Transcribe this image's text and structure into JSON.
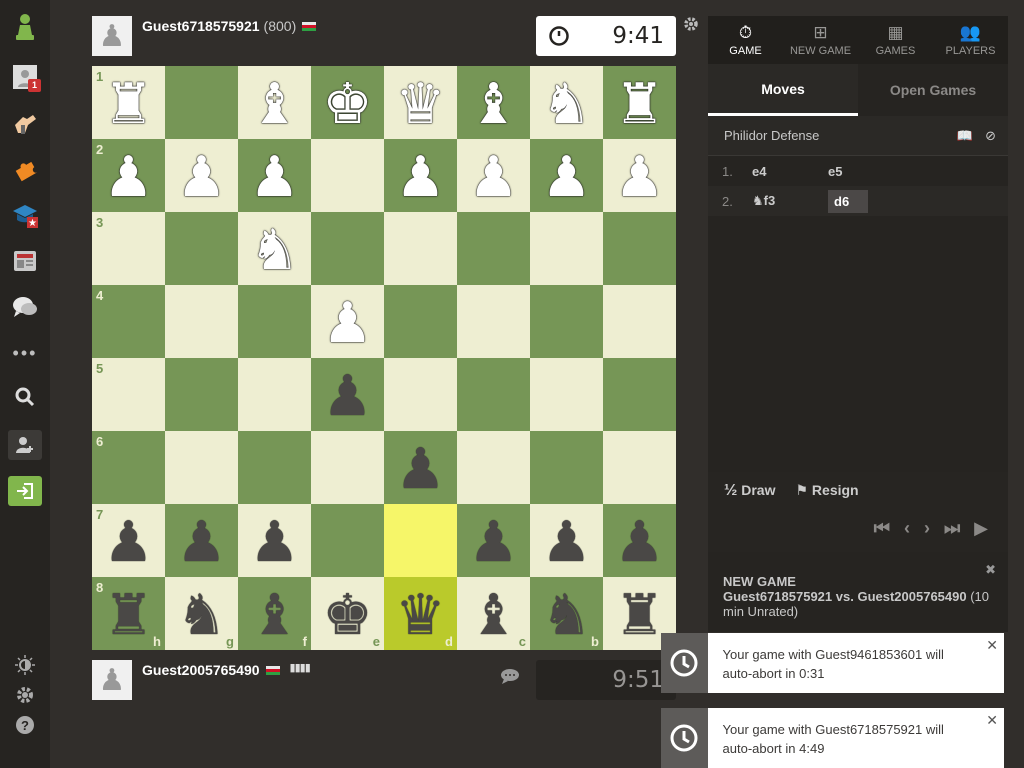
{
  "sidebar": {
    "items": [
      {
        "name": "chess-logo",
        "icon": "pawn-logo-icon"
      },
      {
        "name": "profile",
        "icon": "user-icon",
        "badge": "1"
      },
      {
        "name": "play",
        "icon": "hand-icon"
      },
      {
        "name": "puzzles",
        "icon": "puzzle-icon"
      },
      {
        "name": "learn",
        "icon": "graduation-icon"
      },
      {
        "name": "news",
        "icon": "news-icon"
      },
      {
        "name": "social",
        "icon": "chat-icon"
      },
      {
        "name": "more",
        "icon": "more-icon"
      },
      {
        "name": "search",
        "icon": "search-icon"
      },
      {
        "name": "add-friend",
        "icon": "user-add-icon"
      },
      {
        "name": "login",
        "icon": "login-icon"
      },
      {
        "name": "theme",
        "icon": "brightness-icon"
      },
      {
        "name": "settings",
        "icon": "gear-icon"
      },
      {
        "name": "help",
        "icon": "help-icon"
      }
    ]
  },
  "top_player": {
    "name": "Guest6718575921",
    "rating": "(800)",
    "clock": "9:41"
  },
  "bottom_player": {
    "name": "Guest2005765490",
    "clock": "9:51"
  },
  "board": {
    "ranks": [
      "1",
      "2",
      "3",
      "4",
      "5",
      "6",
      "7",
      "8"
    ],
    "files": [
      "h",
      "g",
      "f",
      "e",
      "d",
      "c",
      "b",
      "a"
    ],
    "pieces": [
      [
        "♜w",
        "",
        "♝w",
        "♚w",
        "♛w",
        "♝w",
        "♞w",
        "♜w"
      ],
      [
        "♟w",
        "♟w",
        "♟w",
        "",
        "♟w",
        "♟w",
        "♟w",
        "♟w"
      ],
      [
        "",
        "",
        "♞w",
        "",
        "",
        "",
        "",
        ""
      ],
      [
        "",
        "",
        "",
        "♟w",
        "",
        "",
        "",
        ""
      ],
      [
        "",
        "",
        "",
        "♟b",
        "",
        "",
        "",
        ""
      ],
      [
        "",
        "",
        "",
        "",
        "♟b",
        "",
        "",
        ""
      ],
      [
        "♟b",
        "♟b",
        "♟b",
        "",
        "",
        "♟b",
        "♟b",
        "♟b"
      ],
      [
        "♜b",
        "♞b",
        "♝b",
        "♚b",
        "♛b",
        "♝b",
        "♞b",
        "♜b"
      ]
    ],
    "highlights": [
      "6-4",
      "7-4"
    ],
    "colors": {
      "light": "#eeeed2",
      "dark": "#769656",
      "hl_light": "#f6f669",
      "hl_dark": "#baca2b"
    }
  },
  "panel": {
    "tabs": [
      {
        "label": "GAME",
        "icon": "stopwatch-icon",
        "active": true
      },
      {
        "label": "NEW GAME",
        "icon": "plus-icon"
      },
      {
        "label": "GAMES",
        "icon": "board-icon"
      },
      {
        "label": "PLAYERS",
        "icon": "players-icon"
      }
    ],
    "subtabs": [
      "Moves",
      "Open Games"
    ],
    "opening": "Philidor Defense",
    "moves": [
      {
        "num": "1.",
        "white": "e4",
        "black": "e5"
      },
      {
        "num": "2.",
        "white": "f3",
        "white_icon": "knight-icon",
        "black": "d6"
      }
    ],
    "draw_label": "Draw",
    "draw_icon": "½",
    "resign_label": "Resign",
    "nav": [
      "⏮",
      "‹",
      "›",
      "⏭",
      "▶"
    ]
  },
  "new_game": {
    "title": "NEW GAME",
    "white": "Guest6718575921",
    "vs": " vs. ",
    "black": "Guest2005765490",
    "detail": " (10 min Unrated)"
  },
  "toasts": [
    {
      "text": "Your game with Guest9461853601 will auto-abort in 0:31"
    },
    {
      "text": "Your game with Guest6718575921 will auto-abort in 4:49"
    }
  ]
}
